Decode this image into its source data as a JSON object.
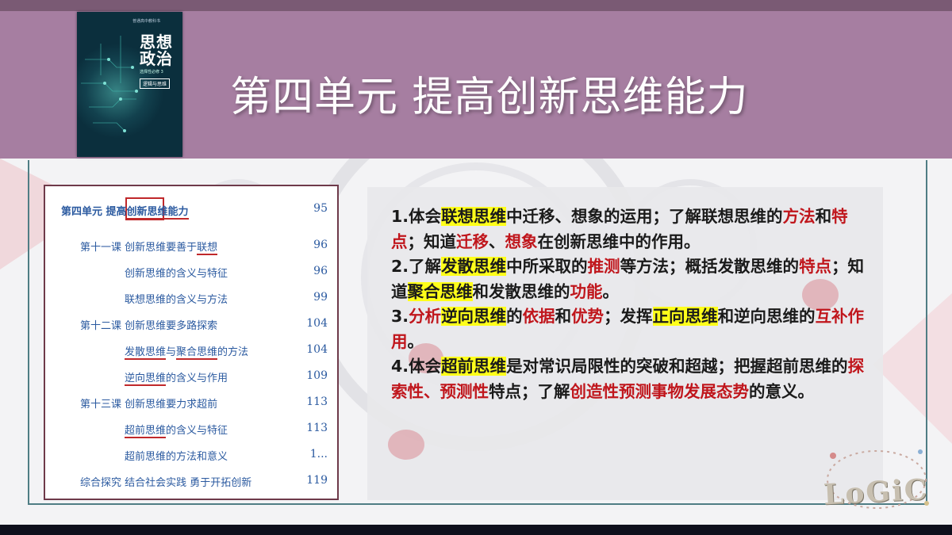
{
  "header": {
    "title": "第四单元  提高创新思维能力"
  },
  "book": {
    "title_line1": "思想",
    "title_line2": "政治",
    "subtitle": "选择性必修 3",
    "tag": "逻辑与思维",
    "publisher": "普通高中教科书"
  },
  "toc": {
    "unit": {
      "prefix": "第四单元  提高",
      "boxed": "创新思维",
      "suffix": "能力",
      "page": "95"
    },
    "rows": [
      {
        "label": "第十一课  创新思维要善于",
        "underlined": "联想",
        "page": "96"
      },
      {
        "label": "创新思维的含义与特征",
        "page": "96"
      },
      {
        "label": "联想思维的含义与方法",
        "page": "99"
      },
      {
        "label": "第十二课  创新思维要多路探索",
        "page": "104"
      },
      {
        "u1": "发散思维",
        "mid": "与",
        "u2": "聚合思维",
        "tail": "的方法",
        "page": "104"
      },
      {
        "u1": "逆向思维",
        "tail": "的含义与作用",
        "page": "109"
      },
      {
        "label": "第十三课  创新思维要力求超前",
        "page": "113"
      },
      {
        "u1": "超前思维",
        "tail": "的含义与特征",
        "page": "113"
      },
      {
        "label": "超前思维的方法和意义",
        "page": "1..."
      },
      {
        "label": "综合探究  结合社会实践  勇于开拓创新",
        "page": "119"
      }
    ]
  },
  "objectives": {
    "item1": {
      "a": "1.体会",
      "b": "联想思维",
      "c": "中迁移、想象的运用；了解联想思维的",
      "d": "方法",
      "e": "和",
      "f": "特点",
      "g": "；知道",
      "h": "迁移",
      "i": "、",
      "j": "想象",
      "k": "在创新思维中的作用。"
    },
    "item2": {
      "a": "2.了解",
      "b": "发散思维",
      "c": "中所采取的",
      "d": "推测",
      "e": "等方法；",
      "f": "概括",
      "g": "发散思维的",
      "h": "特点",
      "i": "；知道",
      "j": "聚合思维",
      "k": "和发散思维的",
      "l": "功能",
      "m": "。"
    },
    "item3": {
      "a": "3.",
      "b": "分析",
      "c": "逆向思维",
      "d": "的",
      "e": "依据",
      "f": "和",
      "g": "优势",
      "h": "；发挥",
      "i": "正向思维",
      "j": "和逆向思维的",
      "k": "互补作用",
      "l": "。"
    },
    "item4": {
      "a": "4.体会",
      "b": "超前思维",
      "c": "是对常识局限性的突破和超越；",
      "d": "把握",
      "e": "超前思维的",
      "f": "探索性、预测性",
      "g": "特点；了解",
      "h": "创造性预测事物发展态势",
      "i": "的意义。"
    }
  },
  "decoration": {
    "logo_text": "LoGiC"
  },
  "colors": {
    "header": "#a67ea1",
    "highlight": "#ffff1a",
    "emphasis_red": "#c0161c",
    "toc_blue": "#2b5aa0"
  }
}
